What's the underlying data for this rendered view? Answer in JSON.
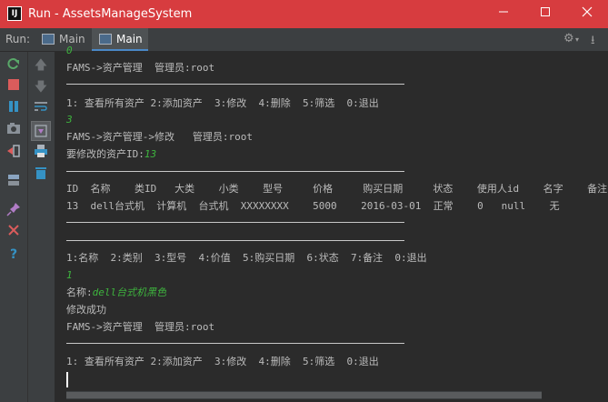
{
  "window": {
    "title": "Run - AssetsManageSystem",
    "app_icon_text": "IJ"
  },
  "runbar": {
    "label": "Run:",
    "tabs": [
      {
        "label": "Main"
      },
      {
        "label": "Main"
      }
    ]
  },
  "console": {
    "lines": {
      "l00": "0",
      "l01": "FAMS->资产管理  管理员:root",
      "l02": "1: 查看所有资产 2:添加资产  3:修改  4:删除  5:筛选  0:退出",
      "l03": "3",
      "l04": "FAMS->资产管理->修改   管理员:root",
      "l05_prefix": "要修改的资产ID:",
      "l05_input": "13",
      "l06": "ID  名称    类ID   大类    小类    型号     价格     购买日期     状态    使用人id    名字    备注",
      "l07": "13  dell台式机  计算机  台式机  XXXXXXXX    5000    2016-03-01  正常    0   null    无",
      "l08": "1:名称  2:类别  3:型号  4:价值  5:购买日期  6:状态  7:备注  0:退出",
      "l09": "1",
      "l10_prefix": "名称:",
      "l10_input": "dell台式机黑色",
      "l11": "修改成功",
      "l12": "FAMS->资产管理  管理员:root",
      "l13": "1: 查看所有资产 2:添加资产  3:修改  4:删除  5:筛选  0:退出"
    }
  },
  "colors": {
    "titlebar": "#d73c3f",
    "console_bg": "#2b2b2b",
    "input_green": "#3eb43e",
    "toolbar_bg": "#3c3f41"
  }
}
